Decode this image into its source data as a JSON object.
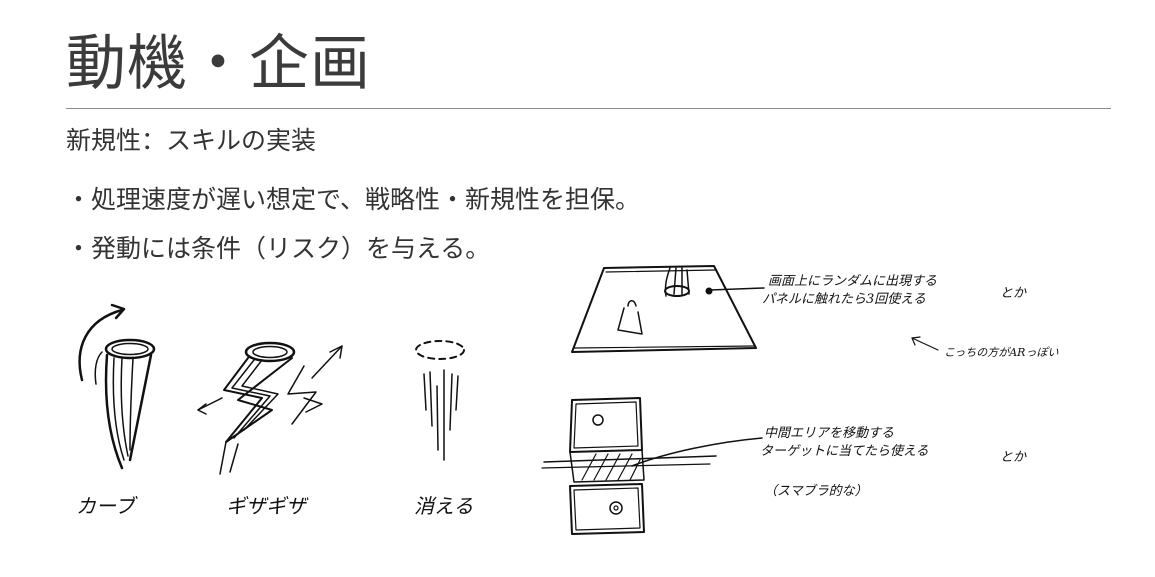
{
  "slide": {
    "title": "動機・企画",
    "lines": [
      "新規性：スキルの実装",
      "・処理速度が遅い想定で、戦略性・新規性を担保。",
      "・発動には条件（リスク）を与える。"
    ]
  },
  "sketches": {
    "motions": [
      {
        "label": "カーブ"
      },
      {
        "label": "ギザギザ"
      },
      {
        "label": "消える"
      }
    ],
    "board_top": {
      "note_line1": "画面上にランダムに出現する",
      "note_line2": "パネルに触れたら3回使える",
      "aside": "とか",
      "ar_note": "こっちの方がARっぽい"
    },
    "board_bottom": {
      "note_line1": "中間エリアを移動する",
      "note_line2": "ターゲットに当てたら使える",
      "note_line3": "（スマブラ的な）",
      "aside": "とか"
    }
  }
}
